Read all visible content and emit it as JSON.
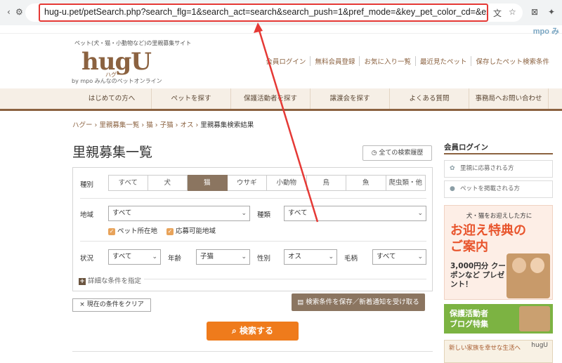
{
  "browser": {
    "url": "hug-u.pet/petSearch.php?search_flg=1&search_act=search&search_push=1&pref_mode=&key_pet_color_cd=&exist_cookie=&save_finish...",
    "bookmark_logo": "mpo み"
  },
  "header": {
    "tagline": "ペット(犬・猫・小動物など)の里親募集サイト",
    "logo": "hugU",
    "logo_kana": "ハグー",
    "byline": "by mpo みんなのペットオンライン",
    "links": [
      "会員ログイン",
      "無料会員登録",
      "お気に入り一覧",
      "最近見たペット",
      "保存したペット検索条件"
    ]
  },
  "nav": [
    "はじめての方へ",
    "ペットを探す",
    "保護活動者を探す",
    "譲渡会を探す",
    "よくある質問",
    "事務局へお問い合わせ"
  ],
  "breadcrumb": [
    "ハグー",
    "里親募集一覧",
    "猫",
    "子猫",
    "オス",
    "里親募集検索結果"
  ],
  "page": {
    "title": "里親募集一覧",
    "history_button": "全ての検索履歴"
  },
  "search": {
    "type_label": "種別",
    "types": [
      "すべて",
      "犬",
      "猫",
      "ウサギ",
      "小動物",
      "鳥",
      "魚",
      "爬虫類・他"
    ],
    "selected_type": "猫",
    "region_label": "地域",
    "region_value": "すべて",
    "breed_label": "種類",
    "breed_value": "すべて",
    "check_pet_location": "ペット所在地",
    "check_apply_region": "応募可能地域",
    "status_label": "状況",
    "status_value": "すべて",
    "age_label": "年齢",
    "age_value": "子猫",
    "sex_label": "性別",
    "sex_value": "オス",
    "coat_label": "毛柄",
    "coat_value": "すべて",
    "more_conditions": "詳細な条件を指定",
    "save_button": "検索条件を保存／新着通知を受け取る",
    "clear_button": "× 現在の条件をクリア",
    "search_button": "検索する"
  },
  "sidebar": {
    "title": "会員ログイン",
    "link_adopter": "里親に応募される方",
    "link_poster": "ペットを掲載される方",
    "promo_line1": "犬・猫をお迎えした方に",
    "promo_line2": "お迎え特典の",
    "promo_line3": "ご案内",
    "promo_coupon": "3,000円分 クーポンなど プレゼント！",
    "blog_line1": "保護活動者",
    "blog_line2": "ブログ特集",
    "banner3_text": "新しい家族を幸せな生活へ",
    "banner3_mark": "hugU"
  },
  "colors": {
    "brand_brown": "#8b6240",
    "accent_orange": "#ef7b1c",
    "annotation_red": "#e53935"
  }
}
